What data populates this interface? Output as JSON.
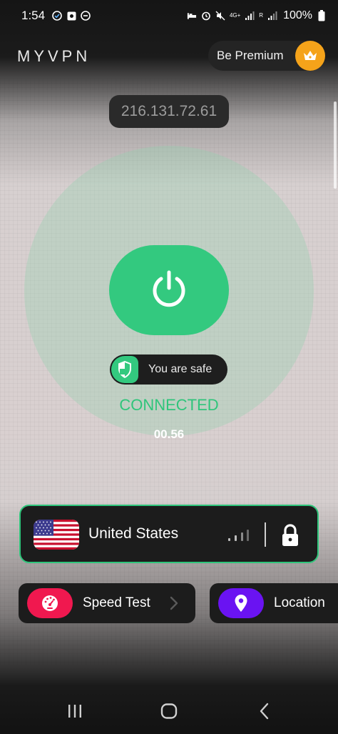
{
  "status_bar": {
    "time": "1:54",
    "network": "4G+",
    "roaming": "R",
    "battery": "100%"
  },
  "header": {
    "logo": "MYVPN",
    "premium_label": "Be Premium"
  },
  "ip_address": "216.131.72.61",
  "connection": {
    "safe_label": "You are safe",
    "status": "CONNECTED",
    "timer": "00.56"
  },
  "server": {
    "country": "United States"
  },
  "tiles": {
    "speed_test": "Speed Test",
    "location": "Location"
  },
  "colors": {
    "accent_green": "#33c97f",
    "premium_orange": "#f5a31a",
    "speed_red": "#f0184f",
    "location_purple": "#6a13f2"
  }
}
